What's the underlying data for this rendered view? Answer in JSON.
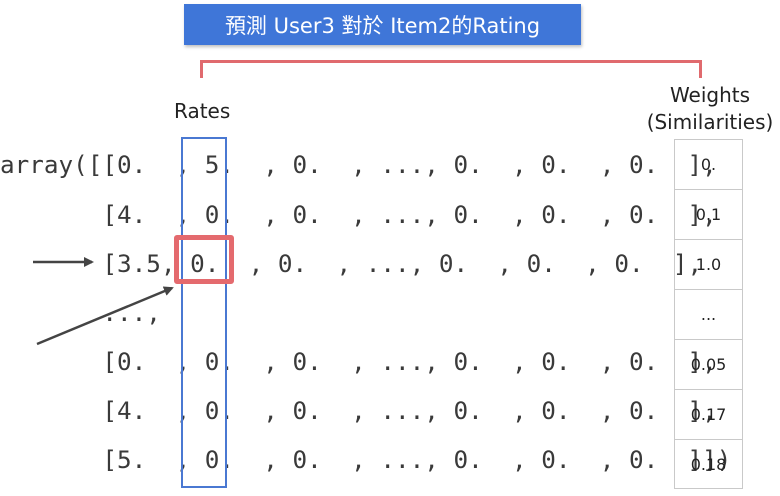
{
  "title": "預測 User3 對於 Item2的Rating",
  "labels": {
    "rates": "Rates",
    "weights_line1": "Weights",
    "weights_line2": "(Similarities)"
  },
  "matrix_lines": [
    "array([[0.  , 5.  , 0.  , ..., 0.  , 0.  , 0.  ],",
    "       [4.  , 0.  , 0.  , ..., 0.  , 0.  , 0.  ],",
    "       [3.5, 0.  , 0.  , ..., 0.  , 0.  , 0.  ],",
    "       ...,",
    "       [0.  , 0.  , 0.  , ..., 0.  , 0.  , 0.  ],",
    "       [4.  , 0.  , 0.  , ..., 0.  , 0.  , 0.  ],",
    "       [5.  , 0.  , 0.  , ..., 0.  , 0.  , 0.  ]])"
  ],
  "weights": [
    "0.",
    "0.1",
    "1.0",
    "...",
    "0.05",
    "0.17",
    "0.18"
  ],
  "colors": {
    "banner": "#3f76d8",
    "highlight": "#e46a6e",
    "rates_box": "#4a78d2",
    "arrow": "#444444"
  }
}
